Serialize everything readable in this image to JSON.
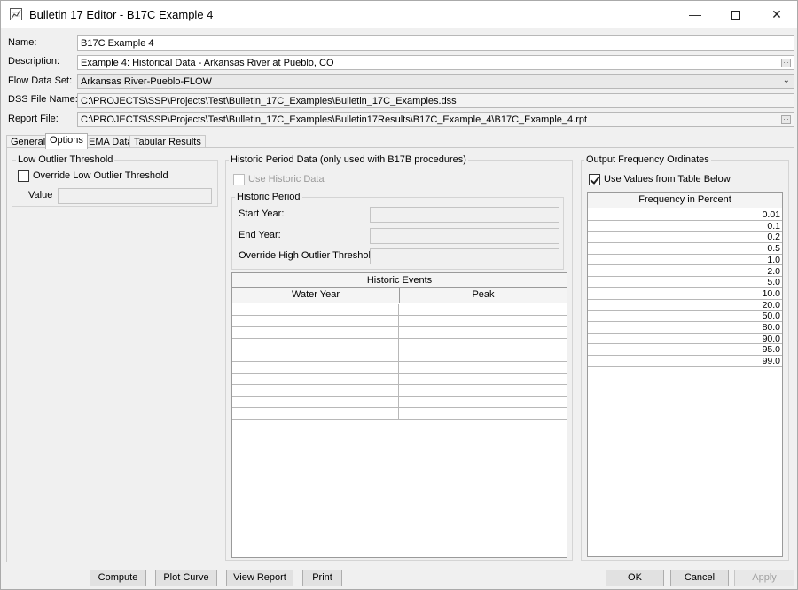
{
  "window": {
    "title": "Bulletin 17 Editor - B17C Example 4",
    "controls": {
      "minimize": "—",
      "close": "✕"
    }
  },
  "form": {
    "name": {
      "label": "Name:",
      "value": "B17C Example 4"
    },
    "description": {
      "label": "Description:",
      "value": "Example 4: Historical Data - Arkansas River at Pueblo, CO",
      "browse": "..."
    },
    "flow_data_set": {
      "label": "Flow Data Set:",
      "value": "Arkansas River-Pueblo-FLOW",
      "arrow": "⌄"
    },
    "dss_file": {
      "label": "DSS File Name:",
      "value": "C:\\PROJECTS\\SSP\\Projects\\Test\\Bulletin_17C_Examples\\Bulletin_17C_Examples.dss",
      "browse": "..."
    },
    "report_file": {
      "label": "Report File:",
      "value": "C:\\PROJECTS\\SSP\\Projects\\Test\\Bulletin_17C_Examples\\Bulletin17Results\\B17C_Example_4\\B17C_Example_4.rpt",
      "browse": "..."
    }
  },
  "tabs": [
    "General",
    "Options",
    "EMA Data",
    "Tabular Results"
  ],
  "active_tab": "Options",
  "low_outlier": {
    "title": "Low Outlier Threshold",
    "override_label": "Override Low Outlier Threshold",
    "override_checked": false,
    "value_label": "Value"
  },
  "historic": {
    "title": "Historic Period Data (only used with B17B procedures)",
    "use_label": "Use Historic Data",
    "use_checked": false,
    "period_title": "Historic Period",
    "start_label": "Start Year:",
    "end_label": "End Year:",
    "override_label": "Override High Outlier Threshold:",
    "events": {
      "title": "Historic Events",
      "columns": [
        "Water Year",
        "Peak"
      ],
      "row_count": 10
    }
  },
  "output_freq": {
    "title": "Output Frequency Ordinates",
    "use_table_label": "Use Values from Table Below",
    "use_table_checked": true,
    "column": "Frequency in Percent",
    "values": [
      "0.01",
      "0.1",
      "0.2",
      "0.5",
      "1.0",
      "2.0",
      "5.0",
      "10.0",
      "20.0",
      "50.0",
      "80.0",
      "90.0",
      "95.0",
      "99.0"
    ]
  },
  "buttons": {
    "compute": "Compute",
    "plot_curve": "Plot Curve",
    "view_report": "View Report",
    "print": "Print",
    "ok": "OK",
    "cancel": "Cancel",
    "apply": "Apply"
  }
}
